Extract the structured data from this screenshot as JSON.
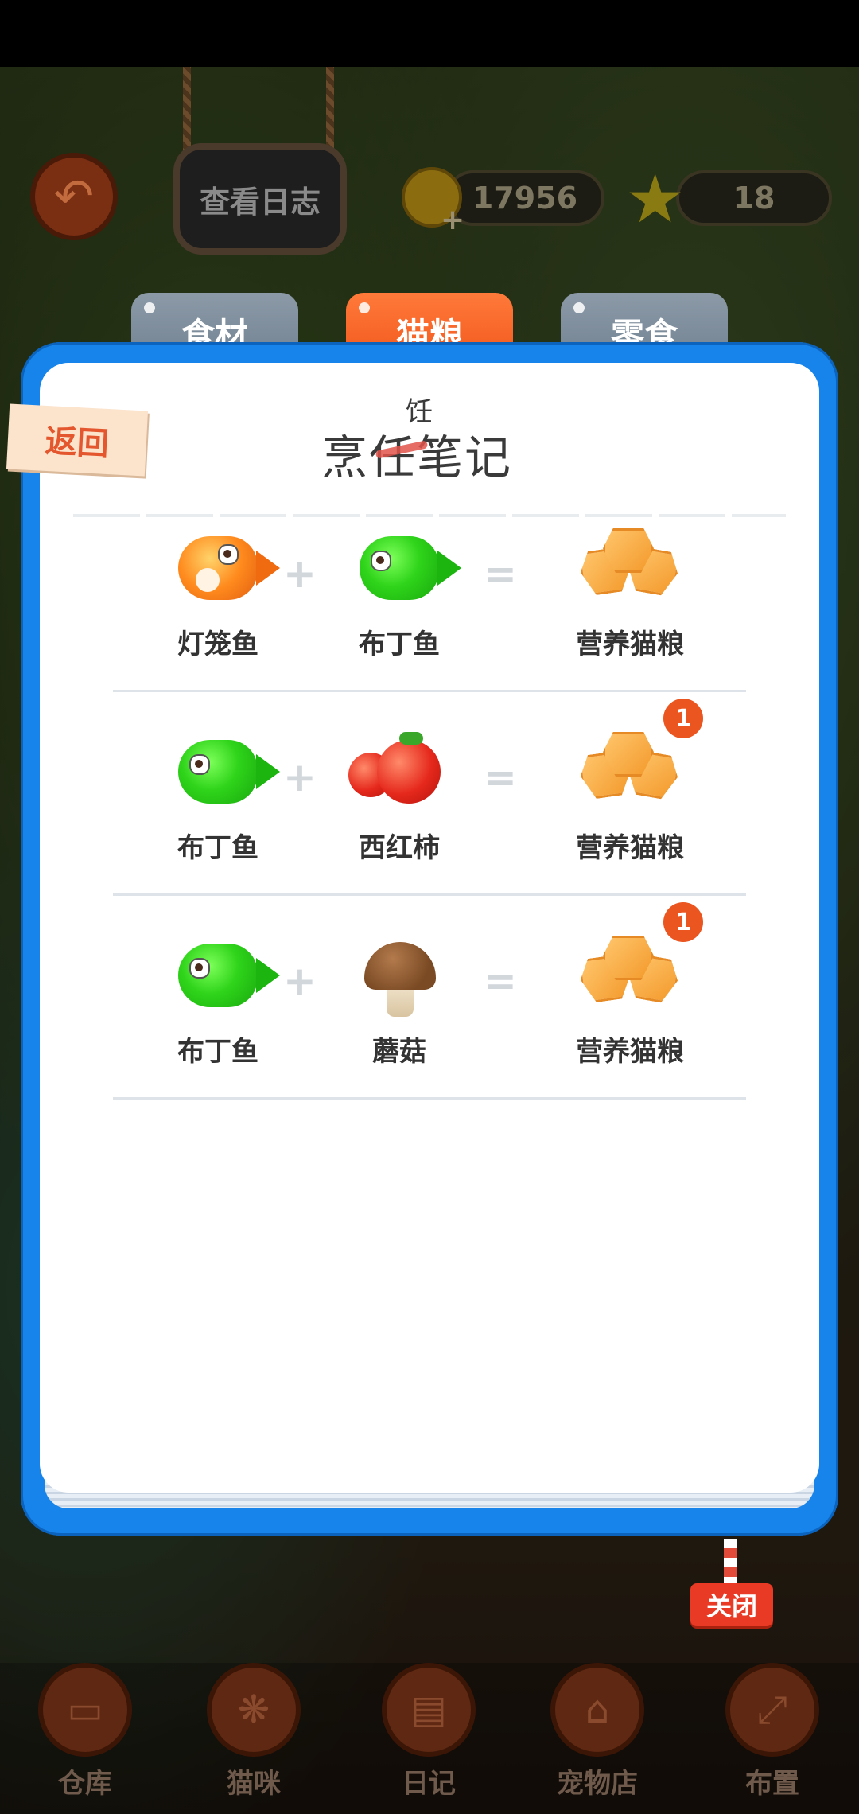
{
  "hud": {
    "log_button": "查看日志",
    "coins": "17956",
    "stars": "18"
  },
  "tabs": [
    {
      "label": "食材",
      "active": false
    },
    {
      "label": "猫粮",
      "active": true
    },
    {
      "label": "零食",
      "active": false
    }
  ],
  "panel": {
    "return_label": "返回",
    "title": "烹饪笔记",
    "title_main": "烹任笔记",
    "title_correction": "饪",
    "close_label": "关闭"
  },
  "recipes": [
    {
      "a": "灯笼鱼",
      "b": "布丁鱼",
      "result": "营养猫粮",
      "badge": ""
    },
    {
      "a": "布丁鱼",
      "b": "西红柿",
      "result": "营养猫粮",
      "badge": "1"
    },
    {
      "a": "布丁鱼",
      "b": "蘑菇",
      "result": "营养猫粮",
      "badge": "1"
    }
  ],
  "operators": {
    "plus": "+",
    "equals": "="
  },
  "bottom_nav": [
    {
      "label": "仓库",
      "icon": "box-icon"
    },
    {
      "label": "猫咪",
      "icon": "paw-icon"
    },
    {
      "label": "日记",
      "icon": "notebook-icon"
    },
    {
      "label": "宠物店",
      "icon": "shop-icon"
    },
    {
      "label": "布置",
      "icon": "expand-icon"
    }
  ],
  "colors": {
    "card_blue": "#1684ea",
    "active_tab": "#f05318",
    "inactive_tab": "#7d8c9a",
    "badge": "#ea5520",
    "close": "#e83a24"
  }
}
